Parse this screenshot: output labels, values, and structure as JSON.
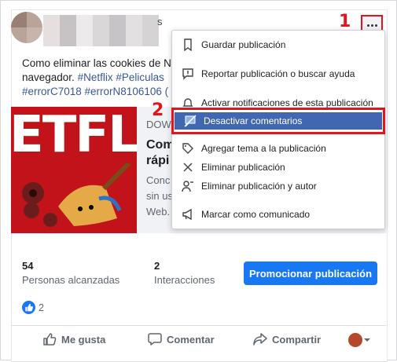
{
  "post": {
    "author_suffix": "s",
    "text_lines": [
      "Como eliminar las cookies de N",
      "navegador. "
    ],
    "hashtags_line2": "#Netflix #Peliculas",
    "hashtags_line3": "#errorC7018 #errorN8106106 (",
    "link": {
      "thumbnail_text": "ETFLI",
      "domain": "DOW",
      "title_lines": [
        "Com",
        "rápi"
      ],
      "desc_lines": [
        "Conc",
        "sin us",
        "Web."
      ]
    }
  },
  "menu": {
    "items": [
      {
        "label": "Guardar publicación",
        "icon": "bookmark-icon"
      },
      {
        "label": "Reportar publicación o buscar ayuda",
        "icon": "report-icon"
      },
      {
        "label": "Activar notificaciones de esta publicación",
        "icon": "bell-icon"
      },
      {
        "label": "Desactivar comentarios",
        "icon": "comment-off-icon"
      },
      {
        "label": "Agregar tema a la publicación",
        "icon": "tag-icon"
      },
      {
        "label": "Eliminar publicación",
        "icon": "close-icon"
      },
      {
        "label": "Eliminar publicación y autor",
        "icon": "user-remove-icon"
      },
      {
        "label": "Marcar como comunicado",
        "icon": "megaphone-icon"
      }
    ]
  },
  "annotations": {
    "step1": "1",
    "step2": "2"
  },
  "stats": {
    "reach_value": "54",
    "reach_label": "Personas alcanzadas",
    "interactions_value": "2",
    "interactions_label": "Interacciones",
    "promote_label": "Promocionar publicación"
  },
  "reactions": {
    "count": "2"
  },
  "actions": {
    "like": "Me gusta",
    "comment": "Comentar",
    "share": "Compartir"
  },
  "colors": {
    "accent": "#1877f2",
    "highlight": "#e0161c",
    "menu_selected": "#4267b2",
    "thumbnail": "#c2131b"
  }
}
